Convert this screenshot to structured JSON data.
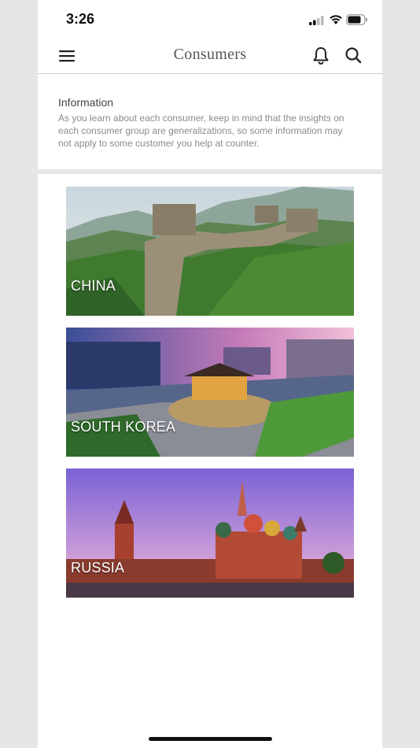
{
  "status_bar": {
    "time": "3:26"
  },
  "header": {
    "title": "Consumers",
    "icons": [
      "menu-icon",
      "bell-icon",
      "search-icon"
    ]
  },
  "info": {
    "title": "Information",
    "text": "As you learn about each consumer, keep in mind that the insights on each consumer group are generalizations, so some information may not apply to some customer you help at counter."
  },
  "countries": [
    {
      "label": "CHINA"
    },
    {
      "label": "SOUTH KOREA"
    },
    {
      "label": "RUSSIA"
    }
  ],
  "colors": {
    "background": "#e6e6e6",
    "card": "#ffffff",
    "title_text": "#555555",
    "body_text": "#8a8a8a"
  }
}
